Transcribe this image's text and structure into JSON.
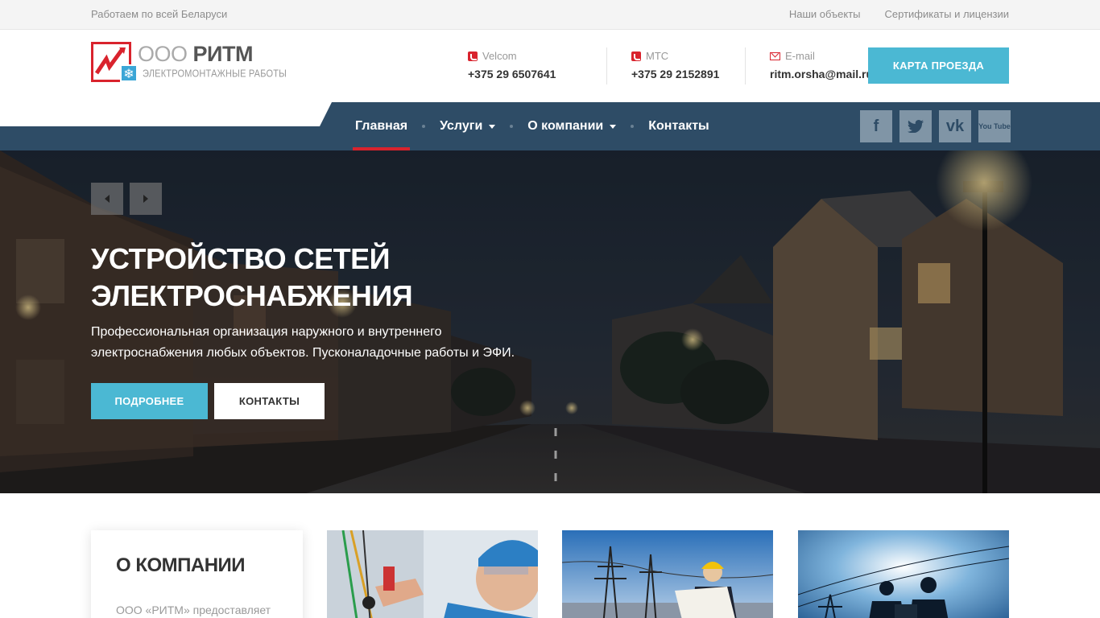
{
  "topbar": {
    "region": "Работаем по всей Беларуси",
    "links": [
      "Наши объекты",
      "Сертификаты и лицензии"
    ]
  },
  "logo": {
    "prefix": "ООО",
    "name": "РИТМ",
    "tagline": "ЭЛЕКТРОМОНТАЖНЫЕ РАБОТЫ"
  },
  "contacts": [
    {
      "label": "Velcom",
      "value": "+375 29 6507641",
      "icon": "phone-icon"
    },
    {
      "label": "МТС",
      "value": "+375 29 2152891",
      "icon": "phone-icon"
    },
    {
      "label": "E-mail",
      "value": "ritm.orsha@mail.ru",
      "icon": "mail-icon"
    }
  ],
  "map_button": "КАРТА ПРОЕЗДА",
  "nav": {
    "items": [
      {
        "label": "Главная",
        "active": true,
        "dropdown": false
      },
      {
        "label": "Услуги",
        "active": false,
        "dropdown": true
      },
      {
        "label": "О компании",
        "active": false,
        "dropdown": true
      },
      {
        "label": "Контакты",
        "active": false,
        "dropdown": false
      }
    ]
  },
  "socials": [
    {
      "name": "facebook-icon",
      "glyph": "f"
    },
    {
      "name": "twitter-icon",
      "glyph": "t"
    },
    {
      "name": "vk-icon",
      "glyph": "vk"
    },
    {
      "name": "youtube-icon",
      "glyph": "You Tube"
    }
  ],
  "hero": {
    "title": "УСТРОЙСТВО СЕТЕЙ ЭЛЕКТРОСНАБЖЕНИЯ",
    "description": "Профессиональная организация наружного и внутреннего электроснабжения любых объектов. Пусконаладочные работы и ЭФИ.",
    "more_button": "ПОДРОБНЕЕ",
    "contacts_button": "КОНТАКТЫ"
  },
  "about": {
    "title": "О КОМПАНИИ",
    "text": "ООО «РИТМ» предоставляет"
  },
  "colors": {
    "accent_red": "#d9232d",
    "accent_blue": "#4bb8d3",
    "nav_bg": "#2e4c66"
  }
}
